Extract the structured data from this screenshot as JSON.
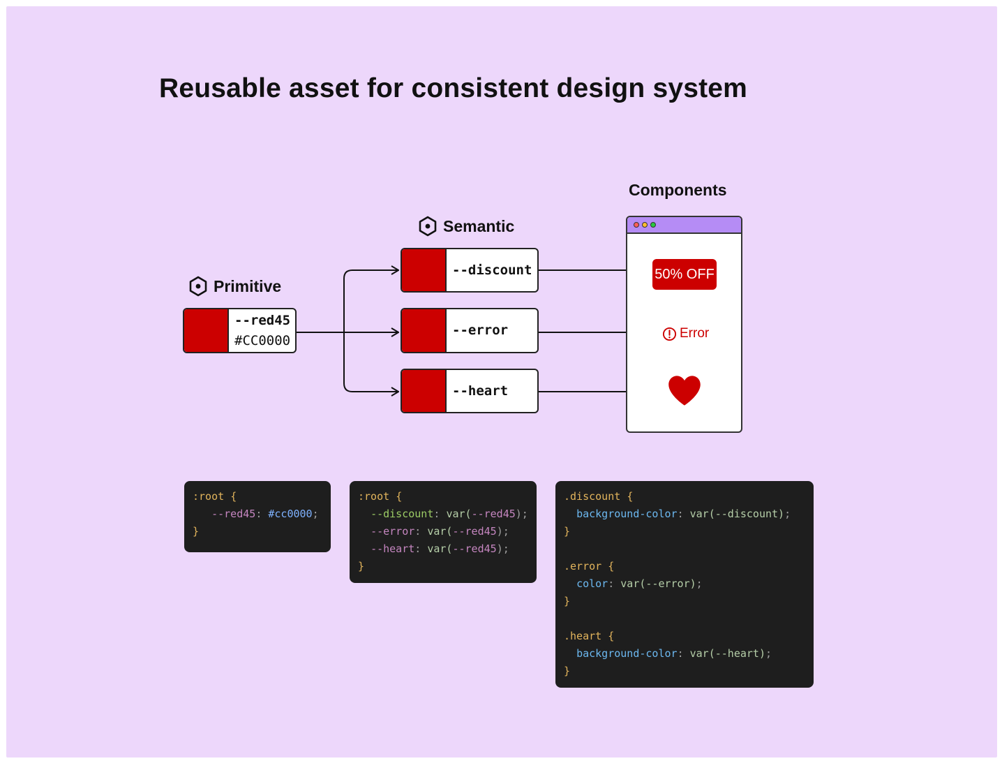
{
  "title": "Reusable asset for consistent design system",
  "headings": {
    "primitive": "Primitive",
    "semantic": "Semantic",
    "components": "Components"
  },
  "primitive": {
    "name": "--red45",
    "hex": "#CC0000"
  },
  "semantic": [
    {
      "name": "--discount"
    },
    {
      "name": "--error"
    },
    {
      "name": "--heart"
    }
  ],
  "components": {
    "badge": "50% OFF",
    "error_label": "Error"
  },
  "colors": {
    "red": "#cc0000",
    "background": "#edd7fb",
    "window_bar": "#b58cf5",
    "dot_red": "#ff5f57",
    "dot_yellow": "#febc2e",
    "dot_green": "#28c840"
  },
  "icons": {
    "primitive": "hexagon-dot-icon",
    "semantic": "hexagon-dot-icon",
    "error": "exclamation-circle-icon",
    "heart": "heart-icon"
  },
  "code": {
    "primitive": {
      "sel": ":root",
      "open": "{",
      "var": "--red45",
      "colon": ":",
      "val": "#cc0000",
      "semi": ";",
      "close": "}"
    },
    "semantic": {
      "sel": ":root",
      "open": "{",
      "close": "}",
      "lines": [
        {
          "name": "--discount",
          "colon": ":",
          "fn": "var(",
          "ref": "--red45",
          "end": ");"
        },
        {
          "name": "--error",
          "colon": ":",
          "fn": "var(",
          "ref": "--red45",
          "end": ");"
        },
        {
          "name": "--heart",
          "colon": ":",
          "fn": "var(",
          "ref": "--red45",
          "end": ");"
        }
      ]
    },
    "component": [
      {
        "sel": ".discount",
        "open": "{",
        "prop": "background-color",
        "colon": ":",
        "value": "var(--discount)",
        "semi": ";",
        "close": "}"
      },
      {
        "sel": ".error",
        "open": "{",
        "prop": "color",
        "colon": ":",
        "value": "var(--error)",
        "semi": ";",
        "close": "}"
      },
      {
        "sel": ".heart",
        "open": "{",
        "prop": "background-color",
        "colon": ":",
        "value": "var(--heart)",
        "semi": ";",
        "close": "}"
      }
    ]
  }
}
